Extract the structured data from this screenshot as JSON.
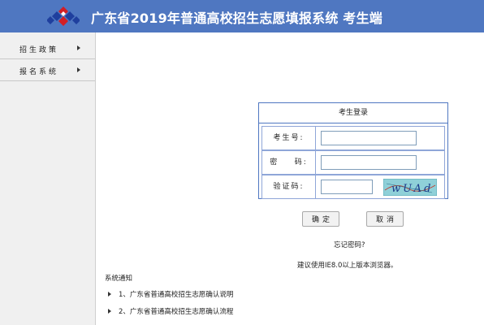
{
  "header": {
    "title": "广东省2019年普通高校招生志愿填报系统  考生端",
    "logo_icon": "diamond-grid-logo",
    "background_color": "#4f77c1"
  },
  "sidebar": {
    "items": [
      {
        "label": "招生政策",
        "icon": "chevron-right-icon"
      },
      {
        "label": "报名系统",
        "icon": "chevron-right-icon"
      }
    ]
  },
  "login": {
    "heading": "考生登录",
    "candidate_label": "考生号:",
    "candidate_value": "",
    "password_label": "密    码:",
    "password_value": "",
    "captcha_label": "验证码:",
    "captcha_value": "",
    "captcha_text": "wUAd",
    "confirm_label": "确定",
    "cancel_label": "取消"
  },
  "forgot_password": "忘记密码?",
  "browser_advice": "建议使用IE8.0以上版本浏览器。",
  "notices": {
    "title": "系统通知",
    "items": [
      {
        "text": "1、广东省普通高校招生志愿确认说明"
      },
      {
        "text": "2、广东省普通高校招生志愿确认流程"
      }
    ]
  }
}
